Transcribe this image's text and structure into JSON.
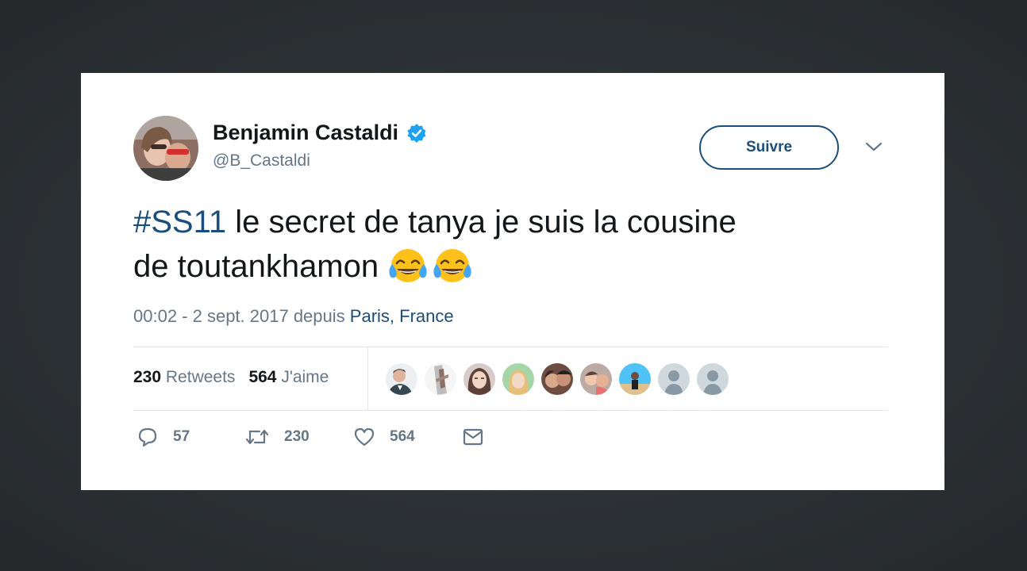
{
  "tweet": {
    "author_name": "Benjamin Castaldi",
    "handle": "@B_Castaldi",
    "follow_label": "Suivre",
    "hashtag": "#SS11",
    "text_line1": "le secret de tanya je suis la cousine",
    "text_line2": "de toutankhamon",
    "emojis": [
      "face-with-tears-of-joy",
      "face-with-tears-of-joy"
    ],
    "timestamp": "00:02 - 2 sept. 2017 depuis",
    "location": "Paris, France",
    "retweets_count": "230",
    "retweets_label": "Retweets",
    "likes_count": "564",
    "likes_label": "J'aime",
    "reply_count": "57",
    "retweet_count": "230",
    "like_count": "564"
  },
  "colors": {
    "link": "#1b4e7c",
    "text": "#14171a",
    "secondary": "#657786",
    "verified": "#1da1f2",
    "divider": "#e1e8ed"
  },
  "likers": [
    "liker-avatar-1",
    "liker-avatar-2",
    "liker-avatar-3",
    "liker-avatar-4",
    "liker-avatar-5",
    "liker-avatar-6",
    "liker-avatar-7",
    "default-avatar",
    "default-avatar"
  ]
}
